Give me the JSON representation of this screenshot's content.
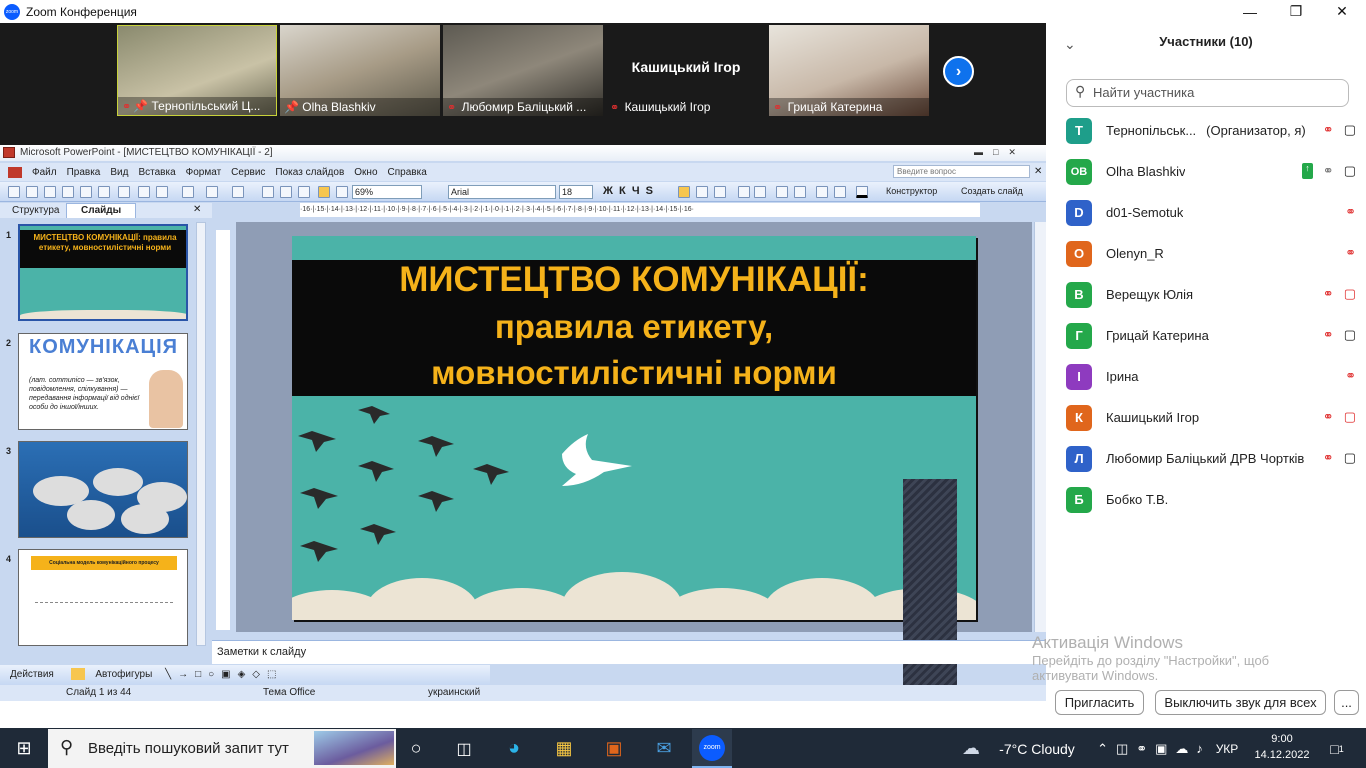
{
  "app": {
    "title": "Zoom Конференция"
  },
  "participants_strip": [
    {
      "name": "Тернопільський Ц...",
      "muted": true,
      "pinned": true
    },
    {
      "name": "Olha Blashkiv",
      "muted": false,
      "pinned": true
    },
    {
      "name": "Любомир Баліцький ...",
      "muted": true,
      "pinned": false
    },
    {
      "name": "Кашицький Ігор",
      "muted": true,
      "pinned": false,
      "big": "Кашицький Ігор"
    },
    {
      "name": "Грицай Катерина",
      "muted": true,
      "pinned": false
    }
  ],
  "ppt": {
    "title": "Microsoft PowerPoint - [МИСТЕЦТВО КОМУНІКАЦІЇ - 2]",
    "ask_placeholder": "Введите вопрос",
    "menu": [
      "Файл",
      "Правка",
      "Вид",
      "Вставка",
      "Формат",
      "Сервис",
      "Показ слайдов",
      "Окно",
      "Справка"
    ],
    "zoom": "69%",
    "font": "Arial",
    "font_size": "18",
    "constructor": "Конструктор",
    "create_slide": "Создать слайд",
    "tabs": {
      "structure": "Структура",
      "slides": "Слайды"
    },
    "thumbs": {
      "s1": {
        "num": "1",
        "text": "МИСТЕЦТВО КОМУНІКАЦІЇ: правила етикету, мовностилістичні норми"
      },
      "s2": {
        "num": "2",
        "title": "КОМУНІКАЦІЯ",
        "text": "(лат. communico — зв'язок, повідомлення, спілкування) — передавання інформації від однієї особи до іншої/інших."
      },
      "s3": {
        "num": "3"
      },
      "s4": {
        "num": "4",
        "title": "Соціальна модель комунікаційного процесу"
      }
    },
    "slide": {
      "line1": "МИСТЕЦТВО КОМУНІКАЦІЇ:",
      "line2": "правила етикету,",
      "line3": "мовностилістичні норми"
    },
    "notes": "Заметки к слайду",
    "actions": "Действия",
    "autoshapes": "Автофигуры",
    "status": {
      "slide": "Слайд 1 из 44",
      "theme": "Тема Office",
      "lang": "украинский"
    }
  },
  "panel": {
    "title": "Участники (10)",
    "search_placeholder": "Найти участника",
    "participants": [
      {
        "initial": "Т",
        "color": "#1e9e8a",
        "name": "Тернопільськ...",
        "role": "(Организатор, я)",
        "mic": "muted",
        "cam": "on"
      },
      {
        "initial": "OB",
        "color": "#24a84a",
        "name": "Olha Blashkiv",
        "mic": "on",
        "cam": "on",
        "share": true
      },
      {
        "initial": "D",
        "color": "#2f62c9",
        "name": "d01-Semotuk",
        "mic": "muted",
        "cam": "none"
      },
      {
        "initial": "O",
        "color": "#e0661c",
        "name": "Olenyn_R",
        "mic": "muted",
        "cam": "none"
      },
      {
        "initial": "В",
        "color": "#24a84a",
        "name": "Верещук Юлія",
        "mic": "muted",
        "cam": "off"
      },
      {
        "initial": "Г",
        "color": "#24a84a",
        "name": "Грицай Катерина",
        "mic": "muted",
        "cam": "on"
      },
      {
        "initial": "І",
        "color": "#8e3bbf",
        "name": "Ірина",
        "mic": "muted",
        "cam": "none"
      },
      {
        "initial": "К",
        "color": "#e0661c",
        "name": "Кашицький Ігор",
        "mic": "muted",
        "cam": "off"
      },
      {
        "initial": "Л",
        "color": "#2f62c9",
        "name": "Любомир Баліцький ДРВ Чортків",
        "mic": "muted",
        "cam": "on"
      },
      {
        "initial": "Б",
        "color": "#24a84a",
        "name": "Бобко Т.В.",
        "mic": "none",
        "cam": "none"
      }
    ],
    "invite": "Пригласить",
    "mute_all": "Выключить звук для всех",
    "more": "..."
  },
  "watermark": {
    "title": "Активація Windows",
    "line1": "Перейдіть до розділу \"Настройки\", щоб",
    "line2": "активувати Windows."
  },
  "taskbar": {
    "search": "Введіть пошуковий запит тут",
    "weather": "-7°C  Cloudy",
    "lang": "УКР",
    "time": "9:00",
    "date": "14.12.2022",
    "notif": "1"
  }
}
